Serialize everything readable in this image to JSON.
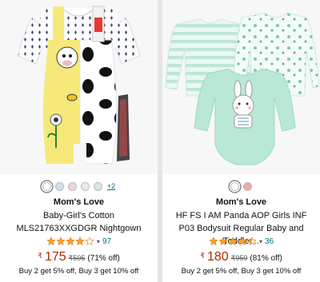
{
  "products": [
    {
      "swatches": [
        {
          "color": "#ffffff",
          "selected": true
        },
        {
          "color": "#cfe0ef",
          "selected": false
        },
        {
          "color": "#f3d3dc",
          "selected": false
        },
        {
          "color": "#e9ecf1",
          "selected": false
        },
        {
          "color": "#cfe9df",
          "selected": false
        }
      ],
      "more_colors": "+2",
      "brand": "Mom's Love",
      "title": "Baby-Girl's Cotton MLS21763XXGDGR Nightgown",
      "rating": 4.0,
      "rating_count": "97",
      "currency": "₹",
      "price": "175",
      "mrp": "595",
      "discount": "(71% off)",
      "offer": "Buy 2 get 5% off, Buy 3 get 10% off"
    },
    {
      "swatches": [
        {
          "color": "#ffffff",
          "selected": true
        },
        {
          "color": "#f1a7a7",
          "selected": false
        }
      ],
      "more_colors": "",
      "brand": "Mom's Love",
      "title": "HF FS I AM Panda AOP Girls INF P03 Bodysuit Regular Baby and Toddler...",
      "rating": 4.5,
      "rating_count": "36",
      "currency": "₹",
      "price": "180",
      "mrp": "959",
      "discount": "(81% off)",
      "offer": "Buy 2 get 5% off, Buy 3 get 10% off"
    }
  ],
  "colors": {
    "price": "#b12704",
    "link": "#007185",
    "star": "#f5a623"
  }
}
